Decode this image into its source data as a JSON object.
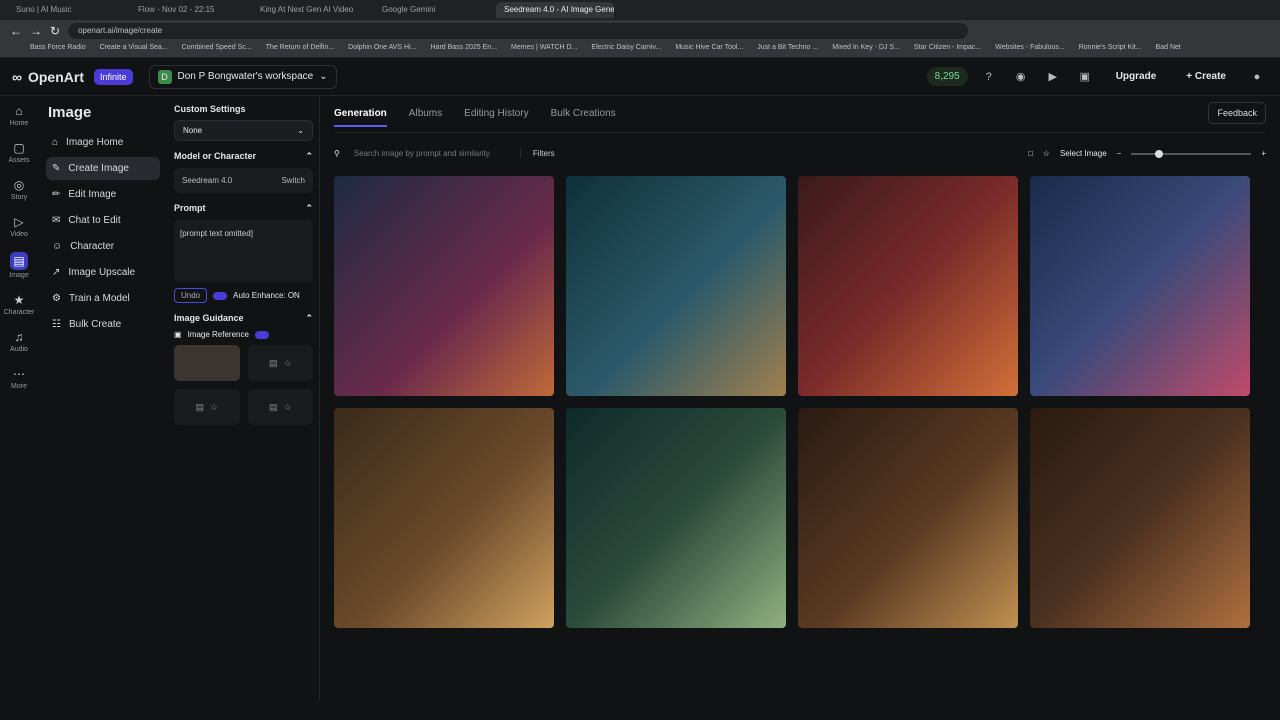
{
  "browser": {
    "tabs": [
      "Suno | AI Music",
      "Flow - Nov 02 - 22:15",
      "King At Next Gen AI Video",
      "Google Gemini",
      "Seedream 4.0 - AI Image Gene..."
    ],
    "url": "openart.ai/image/create",
    "bookmarks": [
      "Bass Force Radio",
      "Create a Visual Sea...",
      "Combined Speed Sc...",
      "The Return of Delfin...",
      "Dolphin One AVS Hi...",
      "Hard Bass 2025 En...",
      "Memes | WATCH D...",
      "Electric Daisy Carniv...",
      "Music Hive Car Tool...",
      "Just a Bit Techno ...",
      "Mixed In Key - DJ S...",
      "Star Citizen - Impac...",
      "Websites - Fabulous...",
      "Ronnie's Script Kit...",
      "Bad Net"
    ]
  },
  "header": {
    "brand": "OpenArt",
    "plan_badge": "Infinite",
    "workspace_initial": "D",
    "workspace": "Don P Bongwater's workspace",
    "credits": "8,295",
    "upgrade": "Upgrade",
    "create": "+ Create"
  },
  "rail": [
    "Home",
    "Assets",
    "Story",
    "Video",
    "Image",
    "Character",
    "Audio",
    "More"
  ],
  "nav": {
    "title": "Image",
    "items": [
      "Image Home",
      "Create Image",
      "Edit Image",
      "Chat to Edit",
      "Character",
      "Image Upscale",
      "Train a Model",
      "Bulk Create"
    ]
  },
  "settings": {
    "custom_settings": "Custom Settings",
    "custom_value": "None",
    "model_header": "Model or Character",
    "model_name": "Seedream 4.0",
    "switch": "Switch",
    "prompt_header": "Prompt",
    "prompt_text": "[prompt text omitted]",
    "undo": "Undo",
    "auto_enhance": "Auto Enhance: ON",
    "guidance_header": "Image Guidance",
    "image_reference": "Image Reference"
  },
  "content": {
    "tabs": [
      "Generation",
      "Albums",
      "Editing History",
      "Bulk Creations"
    ],
    "feedback": "Feedback",
    "search_placeholder": "Search image by prompt and similarity",
    "filters": "Filters",
    "select_image": "Select Image"
  }
}
